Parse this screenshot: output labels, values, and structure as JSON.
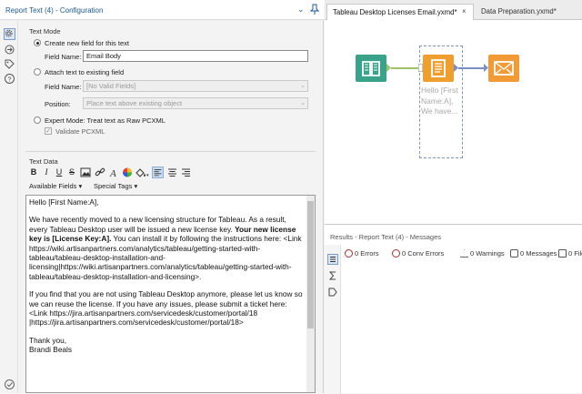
{
  "config_panel": {
    "title": "Report Text (4) - Configuration"
  },
  "text_mode": {
    "group_label": "Text Mode",
    "create_new_label": "Create new field for this text",
    "field_name_label": "Field Name:",
    "field_name_value": "Email Body",
    "attach_label": "Attach text to existing field",
    "attach_field_label": "Field Name:",
    "attach_field_value": "[No Valid Fields]",
    "position_label": "Position:",
    "position_value": "Place text above existing object",
    "expert_label": "Expert Mode: Treat text as Raw PCXML",
    "validate_label": "Validate PCXML"
  },
  "text_data": {
    "group_label": "Text Data",
    "toolbar": {
      "bold": "B",
      "italic": "I",
      "underline": "U",
      "strike": "S"
    },
    "available_fields_label": "Available Fields",
    "special_tags_label": "Special Tags",
    "editor": {
      "greeting": "Hello [First Name:A],",
      "p2_a": "We have recently moved to a new licensing structure for Tableau. As a result, every Tableau Desktop user will be issued a new license key.",
      "p2_bold": "Your new license key is [License Key:A].",
      "p2_b": "You can install it by following the instructions here: <Link https://wiki.artisanpartners.com/analytics/tableau/getting-started-with-tableau/tableau-desktop-installation-and-licensing|https://wiki.artisanpartners.com/analytics/tableau/getting-started-with-tableau/tableau-desktop-installation-and-licensing>.",
      "p3": "If you find that you are not using Tableau Desktop anymore, please let us know so we can reuse the license. If you have any issues, please submit a ticket here: <Link https://jira.artisanpartners.com/servicedesk/customer/portal/18 |https://jira.artisanpartners.com/servicedesk/customer/portal/18>",
      "signoff": "Thank you,",
      "signature": "Brandi Beals"
    }
  },
  "canvas_tabs": [
    {
      "label": "Tableau Desktop Licenses Email.yxmd*"
    },
    {
      "label": "Data Preparation.yxmd*"
    }
  ],
  "canvas": {
    "annotation": "Hello [First Name:A], We have..."
  },
  "results": {
    "title": "Results - Report Text (4) - Messages",
    "errors": "0 Errors",
    "conv_errors": "0 Conv Errors",
    "warnings": "0 Warnings",
    "messages": "0 Messages",
    "files": "0 File"
  }
}
